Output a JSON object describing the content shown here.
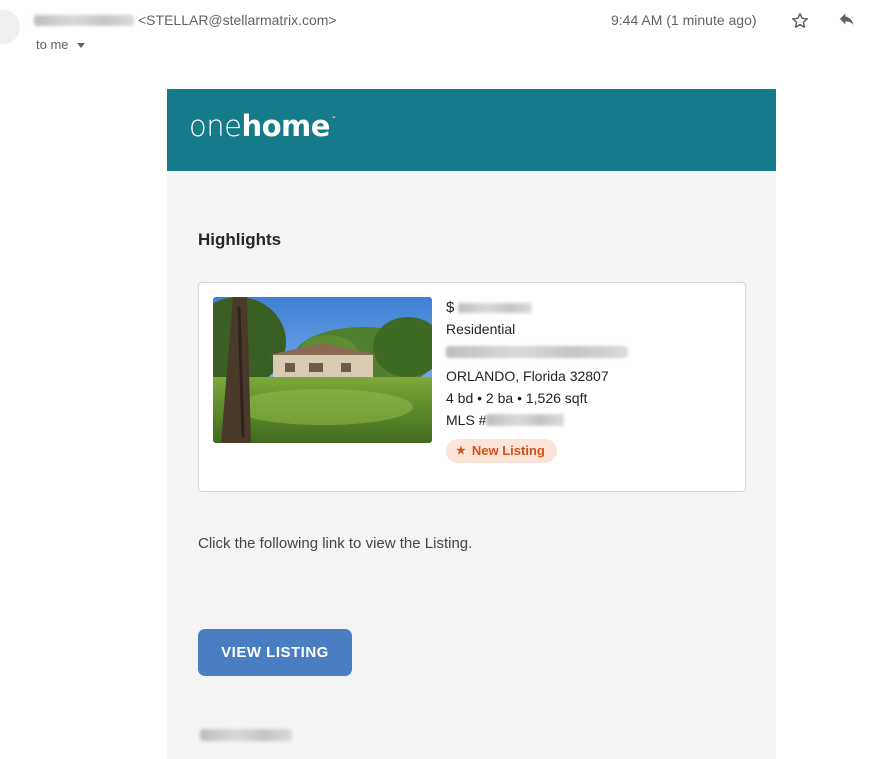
{
  "header": {
    "sender_email": "<STELLAR@stellarmatrix.com>",
    "recipient_label": "to me",
    "timestamp": "9:44 AM (1 minute ago)",
    "icons": {
      "star": "star-icon",
      "reply": "reply-icon",
      "recipient_menu": "chevron-down-icon"
    }
  },
  "email": {
    "brand": {
      "part1": "one",
      "part2": "home",
      "mark": "-",
      "color": "#157a8a"
    },
    "section_title": "Highlights",
    "listing": {
      "price_prefix": "$",
      "property_type": "Residential",
      "city_state_zip": "ORLANDO, Florida 32807",
      "specs": "4 bd • 2 ba • 1,526 sqft",
      "mls_prefix": "MLS #",
      "badge": {
        "icon": "star-icon",
        "label": "New Listing"
      }
    },
    "body_text": "Click the following link to view the Listing.",
    "button_label": "VIEW LISTING",
    "colors": {
      "button": "#4a7ec2",
      "badge_bg": "#fde4d8",
      "badge_text": "#d0531a"
    }
  }
}
